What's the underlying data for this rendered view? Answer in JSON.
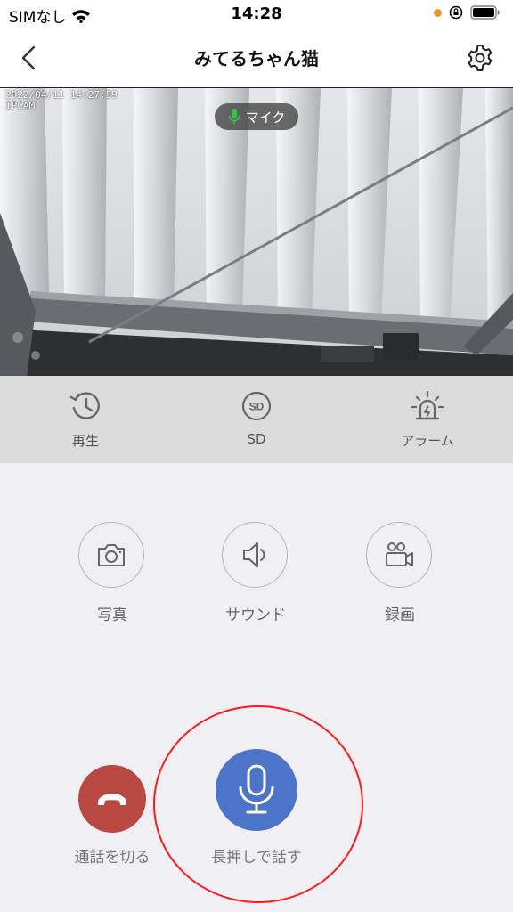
{
  "status_bar": {
    "carrier": "SIMなし",
    "time": "14:28",
    "wifi_icon": "wifi-icon",
    "orientation_lock_icon": "orientation-lock-icon",
    "battery_icon": "battery-icon",
    "dot_color": "#f0952a"
  },
  "nav": {
    "title": "みてるちゃん猫",
    "back_icon": "chevron-left-icon",
    "settings_icon": "gear-icon"
  },
  "camera": {
    "timestamp": "2022/04/11 14:27:59",
    "label": "IPCAM",
    "mic_label": "マイク",
    "mic_color": "#39c24a"
  },
  "toolbar": {
    "items": [
      {
        "label": "再生",
        "icon": "history-icon"
      },
      {
        "label": "SD",
        "icon": "sd-card-icon"
      },
      {
        "label": "アラーム",
        "icon": "alarm-siren-icon"
      }
    ]
  },
  "actions": {
    "items": [
      {
        "label": "写真",
        "icon": "camera-icon"
      },
      {
        "label": "サウンド",
        "icon": "speaker-icon"
      },
      {
        "label": "録画",
        "icon": "video-record-icon"
      }
    ]
  },
  "call": {
    "hangup_label": "通話を切る",
    "hangup_color": "#b84840",
    "talk_label": "長押しで話す",
    "talk_color": "#4c74c8",
    "highlight_color": "#ff1a1a"
  }
}
